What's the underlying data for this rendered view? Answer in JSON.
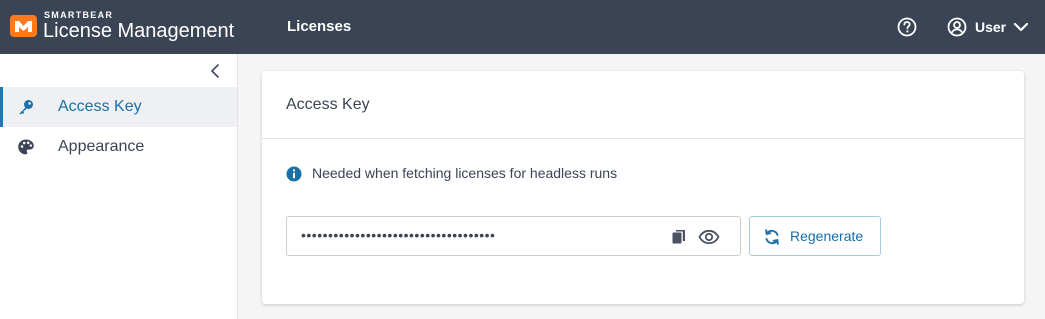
{
  "header": {
    "brand_small": "SMARTBEAR",
    "brand_large": "License Management",
    "nav_licenses": "Licenses",
    "user_label": "User",
    "icons": [
      "logo-icon",
      "help-icon",
      "user-icon",
      "chevron-down-icon"
    ]
  },
  "sidebar": {
    "items": [
      {
        "label": "Access Key",
        "icon": "key-icon",
        "active": true
      },
      {
        "label": "Appearance",
        "icon": "palette-icon",
        "active": false
      }
    ]
  },
  "card": {
    "title": "Access Key",
    "info_text": "Needed when fetching licenses for headless runs",
    "key_masked": "••••••••••••••••••••••••••••••••••••",
    "regenerate_label": "Regenerate"
  },
  "colors": {
    "header_bg": "#3a4455",
    "accent": "#1a6fa5",
    "brand_orange": "#ff7a1e"
  }
}
